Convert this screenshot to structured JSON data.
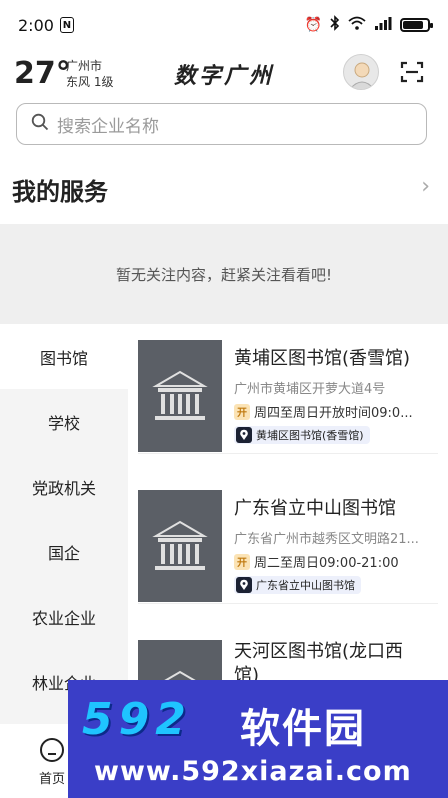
{
  "status_bar": {
    "time": "2:00",
    "nfc": "N"
  },
  "header": {
    "temperature": "27°",
    "city": "广州市",
    "wind": "东风 1级",
    "app_title": "数字广州"
  },
  "search": {
    "placeholder": "搜索企业名称"
  },
  "services": {
    "title": "我的服务",
    "empty_text": "暂无关注内容，赶紧关注看看吧!"
  },
  "categories": [
    "图书馆",
    "学校",
    "党政机关",
    "国企",
    "农业企业",
    "林业企业"
  ],
  "cards": [
    {
      "title": "黄埔区图书馆(香雪馆)",
      "address": "广州市黄埔区开萝大道4号",
      "hours": "周四至周日开放时间09:0...",
      "open_badge": "开",
      "tag": "黄埔区图书馆(香雪馆)"
    },
    {
      "title": "广东省立中山图书馆",
      "address": "广东省广州市越秀区文明路21...",
      "hours": "周二至周日09:00-21:00",
      "open_badge": "开",
      "tag": "广东省立中山图书馆"
    },
    {
      "title": "天河区图书馆(龙口西馆)"
    }
  ],
  "tabbar": {
    "home_label": "首页"
  },
  "watermark": {
    "brand_number": "592",
    "brand_name": "软件园",
    "url": "www.592xiazai.com"
  },
  "colors": {
    "thumb_bg": "#5b5f66",
    "watermark_bg": "#3a3ec7",
    "watermark_accent": "#1fc4ff",
    "badge_bg": "#fbe3b5"
  },
  "battery_level": 0.85
}
